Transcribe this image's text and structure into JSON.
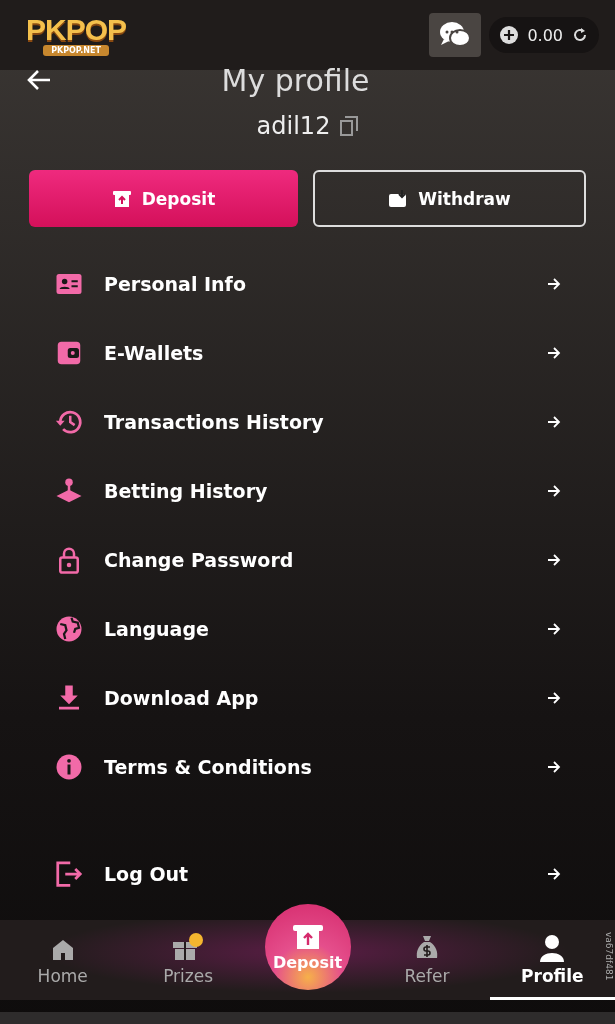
{
  "header": {
    "logo": "PKPOP",
    "logo_sub": "PKPOP.NET",
    "balance": "0.00"
  },
  "title": "My profile",
  "username": "adil12",
  "actions": [
    {
      "label": "Deposit",
      "kind": "primary"
    },
    {
      "label": "Withdraw",
      "kind": "outline"
    }
  ],
  "menu": [
    {
      "label": "Personal Info"
    },
    {
      "label": "E-Wallets"
    },
    {
      "label": "Transactions History"
    },
    {
      "label": "Betting History"
    },
    {
      "label": "Change Password"
    },
    {
      "label": "Language"
    },
    {
      "label": "Download App"
    },
    {
      "label": "Terms & Conditions"
    }
  ],
  "logout": {
    "label": "Log Out"
  },
  "nav": [
    {
      "label": "Home",
      "kind": "tab",
      "selected": false
    },
    {
      "label": "Prizes",
      "kind": "tab",
      "selected": false
    },
    {
      "label": "Deposit",
      "kind": "center",
      "selected": false
    },
    {
      "label": "Refer",
      "kind": "tab",
      "selected": false
    },
    {
      "label": "Profile",
      "kind": "tab",
      "selected": true
    }
  ],
  "build_id": "va67df481"
}
